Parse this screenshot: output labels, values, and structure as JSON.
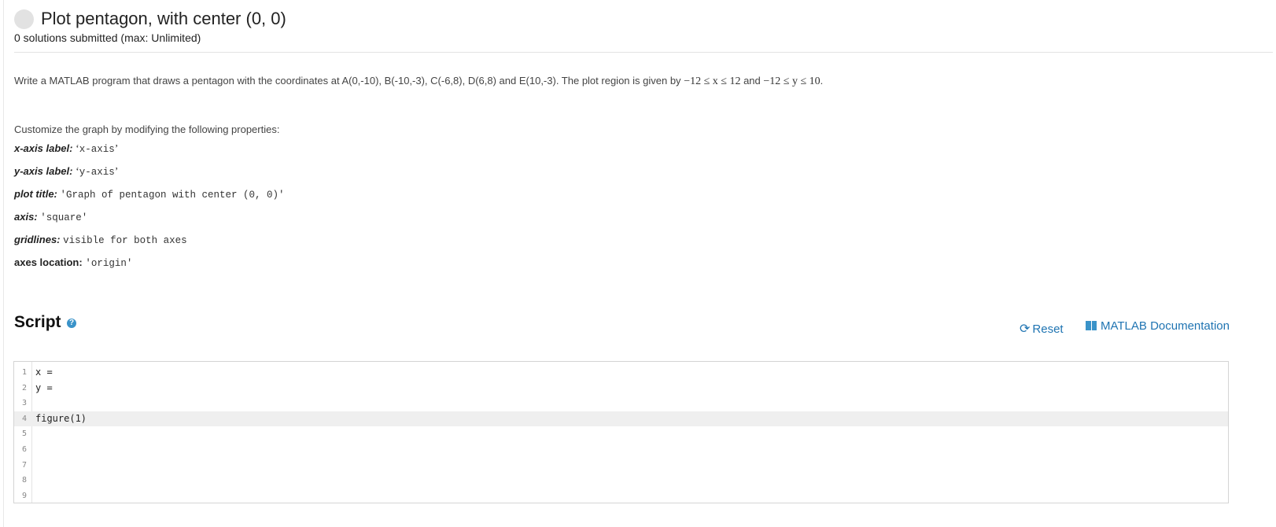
{
  "problem": {
    "title": "Plot pentagon, with center (0, 0)",
    "submissions": "0 solutions submitted (max: Unlimited)"
  },
  "description": {
    "intro": "Write a MATLAB program that draws a pentagon with the coordinates at  A(0,-10), B(-10,-3), C(-6,8), D(6,8) and E(10,-3). The plot region is given by",
    "x_range": "−12 ≤ x ≤ 12",
    "and": "and",
    "y_range": "−12 ≤ y ≤ 10",
    "end": "."
  },
  "customize": {
    "intro": "Customize the graph by modifying the following properties:",
    "properties": [
      {
        "label": "x-axis label:",
        "value": "x-axis"
      },
      {
        "label": "y-axis label:",
        "value": "y-axis"
      },
      {
        "label": "plot title:",
        "value": "'Graph of pentagon with center (0, 0)'"
      },
      {
        "label": "axis:",
        "value": "'square'"
      },
      {
        "label": "gridlines:",
        "value": "visible for both axes"
      },
      {
        "label": "axes location:",
        "value": "'origin'"
      }
    ]
  },
  "script": {
    "heading": "Script",
    "help_icon": "?",
    "reset_icon": "refresh-icon",
    "reset_label": "Reset",
    "doc_icon": "book-icon",
    "doc_label": "MATLAB Documentation"
  },
  "editor": {
    "line_numbers": [
      "1",
      "2",
      "3",
      "4",
      "5",
      "6",
      "7",
      "8",
      "9"
    ],
    "lines": [
      "x =",
      "y =",
      "",
      "figure(1)",
      "",
      "",
      "",
      "",
      ""
    ],
    "active_line": 4
  }
}
